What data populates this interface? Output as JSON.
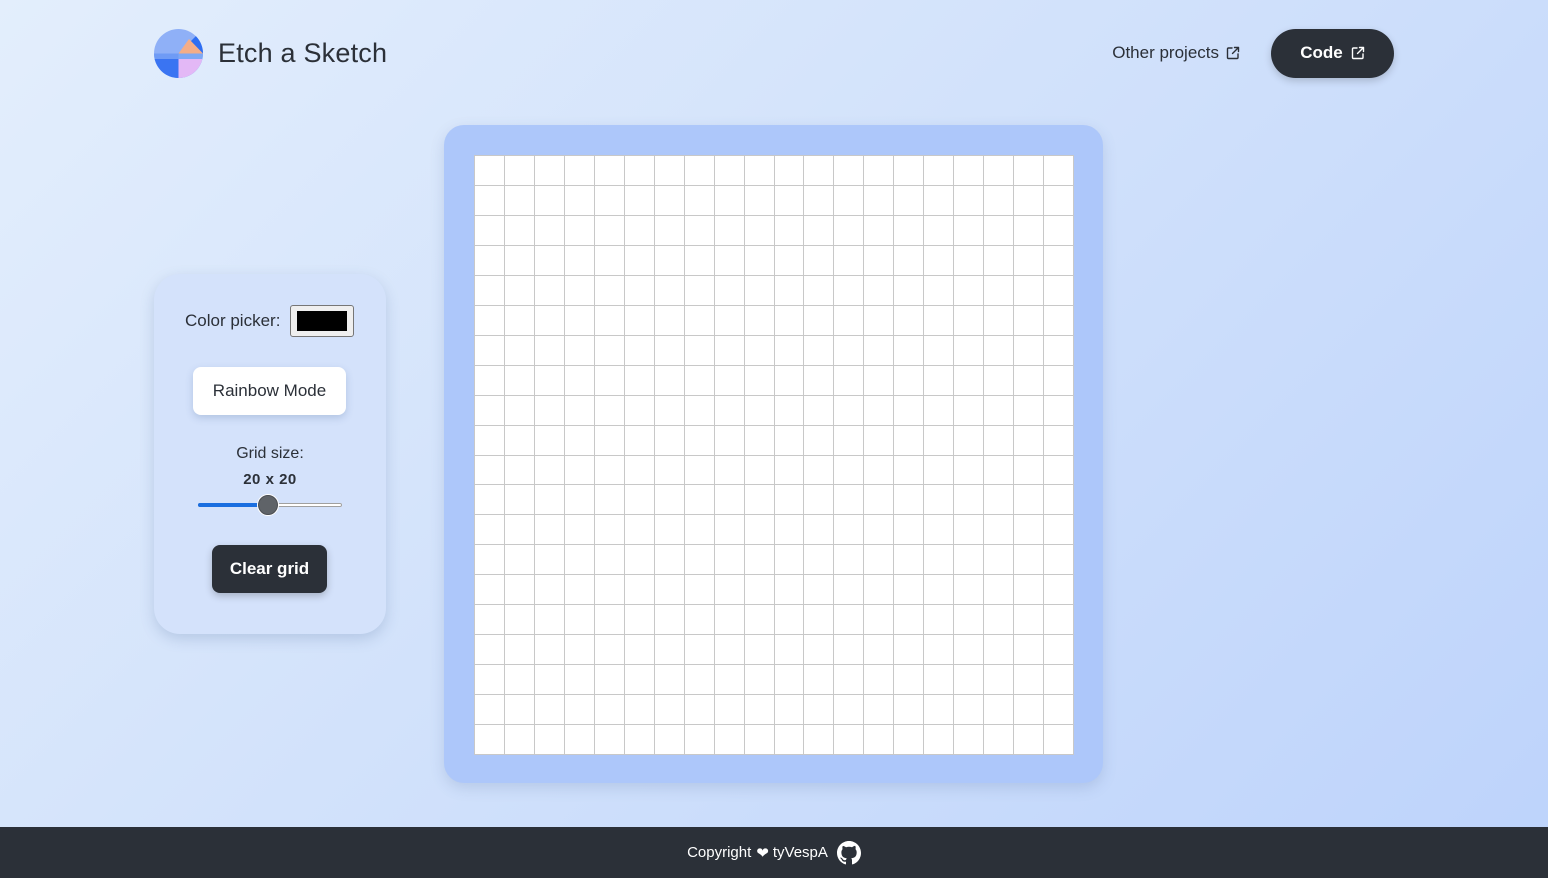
{
  "header": {
    "title": "Etch a Sketch",
    "nav_other_projects": "Other projects",
    "code_button": "Code"
  },
  "controls": {
    "color_picker_label": "Color picker:",
    "color_value": "#000000",
    "rainbow_button": "Rainbow Mode",
    "grid_size_label": "Grid size:",
    "grid_size_value": "20 x 20",
    "slider_fraction": 0.48,
    "clear_button": "Clear grid"
  },
  "grid": {
    "rows": 20,
    "cols": 20
  },
  "footer": {
    "copyright": "Copyright",
    "heart_icon": "heart-icon",
    "author": "tyVespA",
    "github_icon": "github-icon"
  },
  "colors": {
    "dark": "#2b3038",
    "board": "#adc7fa",
    "panel": "#d4e2fb",
    "slider_accent": "#1a6ee0"
  }
}
